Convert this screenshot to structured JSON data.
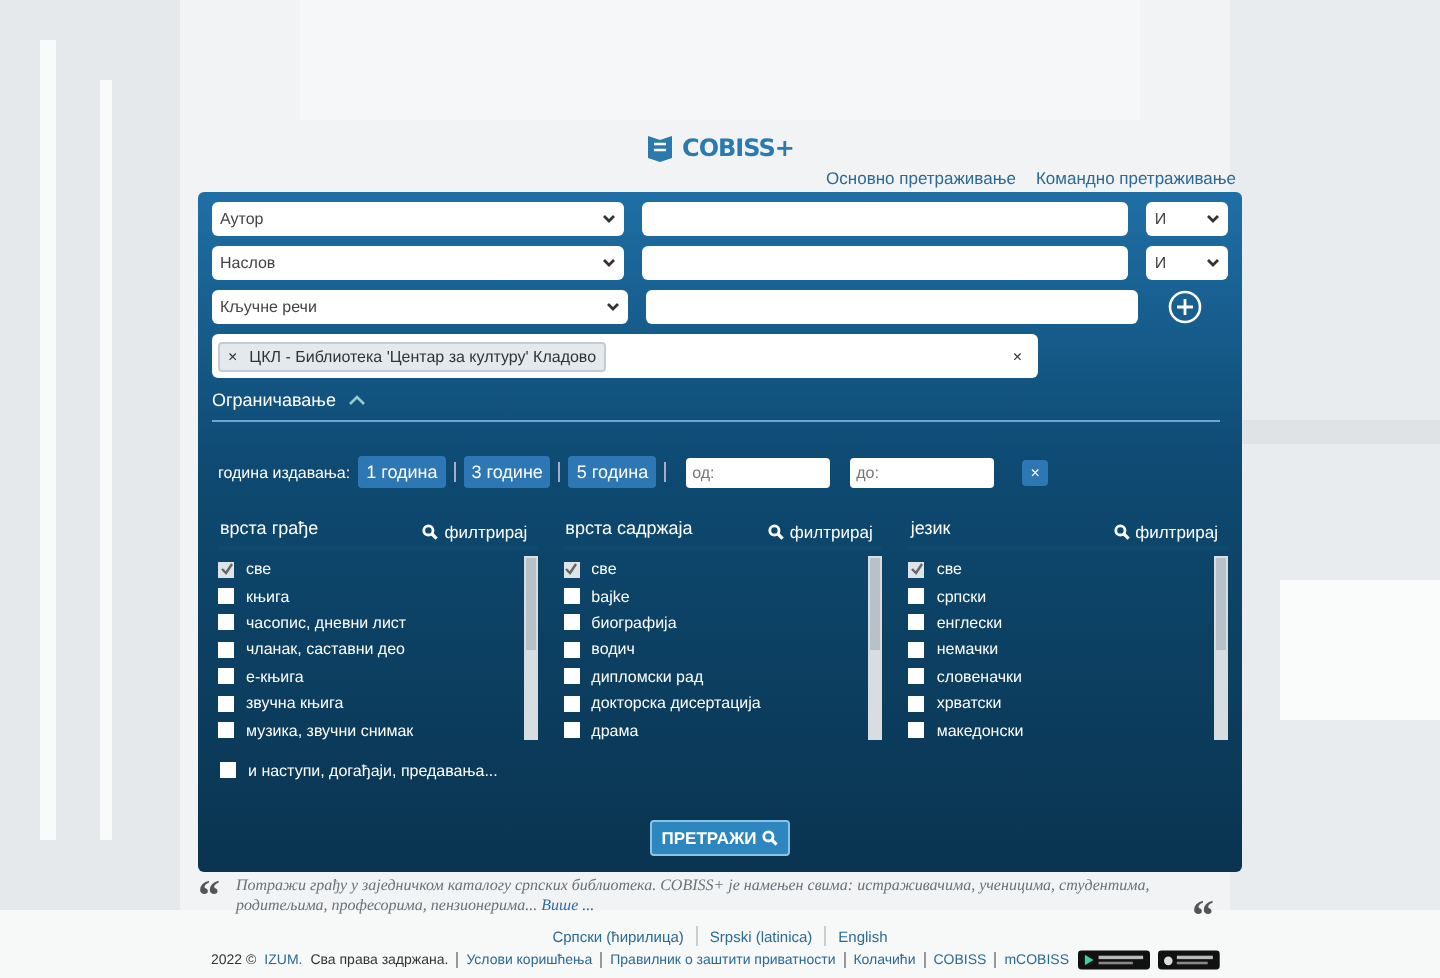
{
  "header": {
    "logo": "COBISS+",
    "links": [
      "Основно претраживање",
      "Командно претраживање"
    ]
  },
  "search_rows": [
    {
      "field": "Аутор",
      "value": "",
      "operator": "И",
      "kind": "operator"
    },
    {
      "field": "Наслов",
      "value": "",
      "operator": "И",
      "kind": "operator"
    },
    {
      "field": "Кључне речи",
      "value": "",
      "kind": "add"
    }
  ],
  "library_filter": {
    "chip": "ЦКЛ - Библиотека 'Центар за културу' Кладово",
    "chip_remove": "×",
    "clear": "×"
  },
  "restrict": {
    "title": "Ограничавање",
    "expanded": true
  },
  "year": {
    "label": "година издавања:",
    "buttons": [
      "1 година",
      "3 године",
      "5 година"
    ],
    "from_placeholder": "од:",
    "to_placeholder": "до:",
    "clear": "×"
  },
  "filters": [
    {
      "title": "врста грађе",
      "filter": "филтрирај",
      "items": [
        {
          "label": "све",
          "checked": true
        },
        {
          "label": "књига",
          "checked": false
        },
        {
          "label": "часопис, дневни лист",
          "checked": false
        },
        {
          "label": "чланак, саставни део",
          "checked": false
        },
        {
          "label": "е-књига",
          "checked": false
        },
        {
          "label": "звучна књига",
          "checked": false
        },
        {
          "label": "музика, звучни снимак",
          "checked": false
        }
      ]
    },
    {
      "title": "врста садржаја",
      "filter": "филтрирај",
      "items": [
        {
          "label": "све",
          "checked": true
        },
        {
          "label": "bajke",
          "checked": false
        },
        {
          "label": "биографија",
          "checked": false
        },
        {
          "label": "водич",
          "checked": false
        },
        {
          "label": "дипломски рад",
          "checked": false
        },
        {
          "label": "докторска дисертација",
          "checked": false
        },
        {
          "label": "драма",
          "checked": false
        }
      ]
    },
    {
      "title": "језик",
      "filter": "филтрирај",
      "items": [
        {
          "label": "све",
          "checked": true
        },
        {
          "label": "српски",
          "checked": false
        },
        {
          "label": "енглески",
          "checked": false
        },
        {
          "label": "немачки",
          "checked": false
        },
        {
          "label": "словеначки",
          "checked": false
        },
        {
          "label": "хрватски",
          "checked": false
        },
        {
          "label": "македонски",
          "checked": false
        }
      ]
    }
  ],
  "events": {
    "label": "и наступи, догађаји, предавања...",
    "checked": false
  },
  "search_button": "ПРЕТРАЖИ",
  "quote": {
    "open": "“",
    "close": "“",
    "text": "Потражи грађу у заједничком каталогу српских библиотека. COBISS+ је намењен свима: истраживачима, ученицима, студентима, родитељима, професорима, пензионерима...",
    "more": "Више ..."
  },
  "languages": [
    "Српски (ћирилица)",
    "Srpski (latinica)",
    "English"
  ],
  "footer": {
    "year": "2022 ©",
    "org": "IZUM.",
    "rights": "Сва права задржана.",
    "links": [
      "Услови коришћења",
      "Правилник о заштити приватности",
      "Колачићи",
      "COBISS",
      "mCOBISS"
    ]
  }
}
